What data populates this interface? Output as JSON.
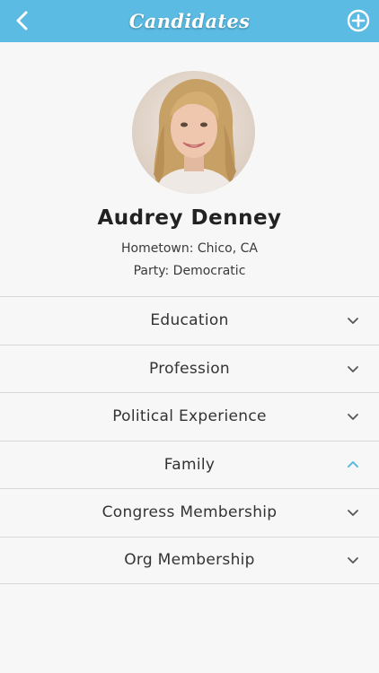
{
  "app": {
    "accent_color": "#5bbbe3"
  },
  "navbar": {
    "title": "Candidates",
    "back_icon": "chevron-left-icon",
    "add_icon": "plus-circle-icon"
  },
  "profile": {
    "name": "Audrey Denney",
    "hometown": "Hometown: Chico, CA",
    "party": "Party: Democratic"
  },
  "sections": [
    {
      "label": "Education",
      "state": "collapsed"
    },
    {
      "label": "Profession",
      "state": "collapsed"
    },
    {
      "label": "Political Experience",
      "state": "collapsed"
    },
    {
      "label": "Family",
      "state": "expanded"
    },
    {
      "label": "Congress Membership",
      "state": "collapsed"
    },
    {
      "label": "Org Membership",
      "state": "collapsed"
    }
  ]
}
